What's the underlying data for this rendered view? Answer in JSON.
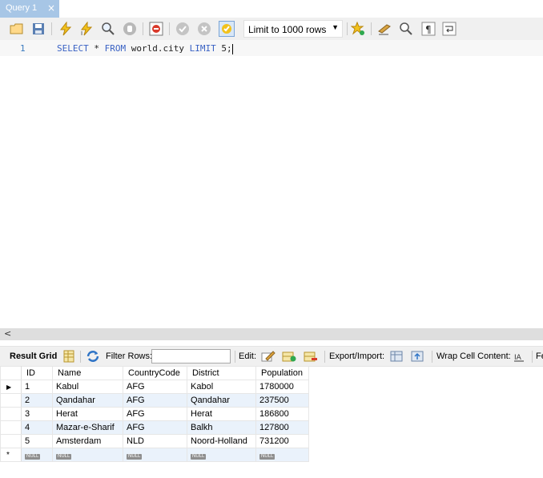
{
  "tab": {
    "label": "Query 1",
    "close": "×"
  },
  "toolbar": {
    "limit_label": "Limit to 1000 rows",
    "icons": [
      "open-folder-icon",
      "save-icon",
      "execute-icon",
      "execute-current-icon",
      "explain-icon",
      "stop-icon",
      "toggle-error-icon",
      "commit-icon",
      "rollback-icon",
      "autocommit-icon",
      "bookmark-icon",
      "beautify-icon",
      "find-icon",
      "invisible-chars-icon",
      "wrap-icon"
    ]
  },
  "editor": {
    "line_number": "1",
    "tokens": {
      "select": "SELECT",
      "star": "*",
      "from": "FROM",
      "table": "world.city",
      "limit": "LIMIT",
      "num": "5",
      "semi": ";"
    }
  },
  "result_toolbar": {
    "result_grid": "Result Grid",
    "filter_rows": "Filter Rows:",
    "edit": "Edit:",
    "export_import": "Export/Import:",
    "wrap_cell": "Wrap Cell Content:",
    "fe": "Fe"
  },
  "grid": {
    "columns": [
      "ID",
      "Name",
      "CountryCode",
      "District",
      "Population"
    ],
    "rows": [
      [
        "1",
        "Kabul",
        "AFG",
        "Kabol",
        "1780000"
      ],
      [
        "2",
        "Qandahar",
        "AFG",
        "Qandahar",
        "237500"
      ],
      [
        "3",
        "Herat",
        "AFG",
        "Herat",
        "186800"
      ],
      [
        "4",
        "Mazar-e-Sharif",
        "AFG",
        "Balkh",
        "127800"
      ],
      [
        "5",
        "Amsterdam",
        "NLD",
        "Noord-Holland",
        "731200"
      ]
    ],
    "null_label": "NULL",
    "current_row_marker": "▶",
    "new_row_marker": "*"
  },
  "colors": {
    "tab_active": "#a7c6e6",
    "keyword": "#3a62c4",
    "row_alt": "#eaf2fb"
  }
}
